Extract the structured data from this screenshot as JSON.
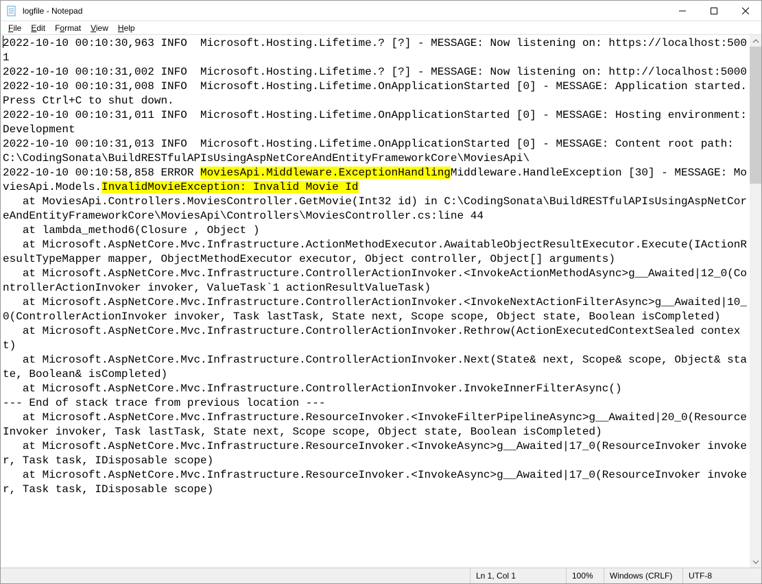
{
  "window": {
    "title": "logfile - Notepad"
  },
  "menu": {
    "file": "File",
    "edit": "Edit",
    "format": "Format",
    "view": "View",
    "help": "Help"
  },
  "log": {
    "pre1": "2022-10-10 00:10:30,963 INFO  Microsoft.Hosting.Lifetime.? [?] - MESSAGE: Now listening on: https://localhost:5001\n2022-10-10 00:10:31,002 INFO  Microsoft.Hosting.Lifetime.? [?] - MESSAGE: Now listening on: http://localhost:5000\n2022-10-10 00:10:31,008 INFO  Microsoft.Hosting.Lifetime.OnApplicationStarted [0] - MESSAGE: Application started. Press Ctrl+C to shut down.\n2022-10-10 00:10:31,011 INFO  Microsoft.Hosting.Lifetime.OnApplicationStarted [0] - MESSAGE: Hosting environment: Development\n2022-10-10 00:10:31,013 INFO  Microsoft.Hosting.Lifetime.OnApplicationStarted [0] - MESSAGE: Content root path: C:\\CodingSonata\\BuildRESTfulAPIsUsingAspNetCoreAndEntityFrameworkCore\\MoviesApi\\\n2022-10-10 00:10:58,858 ERROR ",
    "hl1": "MoviesApi.Middleware.ExceptionHandling",
    "mid1": "Middleware.HandleException [30] - MESSAGE: MoviesApi.Models.",
    "hl2": "InvalidMovieException: Invalid Movie Id",
    "post1": "\n   at MoviesApi.Controllers.MoviesController.GetMovie(Int32 id) in C:\\CodingSonata\\BuildRESTfulAPIsUsingAspNetCoreAndEntityFrameworkCore\\MoviesApi\\Controllers\\MoviesController.cs:line 44\n   at lambda_method6(Closure , Object )\n   at Microsoft.AspNetCore.Mvc.Infrastructure.ActionMethodExecutor.AwaitableObjectResultExecutor.Execute(IActionResultTypeMapper mapper, ObjectMethodExecutor executor, Object controller, Object[] arguments)\n   at Microsoft.AspNetCore.Mvc.Infrastructure.ControllerActionInvoker.<InvokeActionMethodAsync>g__Awaited|12_0(ControllerActionInvoker invoker, ValueTask`1 actionResultValueTask)\n   at Microsoft.AspNetCore.Mvc.Infrastructure.ControllerActionInvoker.<InvokeNextActionFilterAsync>g__Awaited|10_0(ControllerActionInvoker invoker, Task lastTask, State next, Scope scope, Object state, Boolean isCompleted)\n   at Microsoft.AspNetCore.Mvc.Infrastructure.ControllerActionInvoker.Rethrow(ActionExecutedContextSealed context)\n   at Microsoft.AspNetCore.Mvc.Infrastructure.ControllerActionInvoker.Next(State& next, Scope& scope, Object& state, Boolean& isCompleted)\n   at Microsoft.AspNetCore.Mvc.Infrastructure.ControllerActionInvoker.InvokeInnerFilterAsync()\n--- End of stack trace from previous location ---\n   at Microsoft.AspNetCore.Mvc.Infrastructure.ResourceInvoker.<InvokeFilterPipelineAsync>g__Awaited|20_0(ResourceInvoker invoker, Task lastTask, State next, Scope scope, Object state, Boolean isCompleted)\n   at Microsoft.AspNetCore.Mvc.Infrastructure.ResourceInvoker.<InvokeAsync>g__Awaited|17_0(ResourceInvoker invoker, Task task, IDisposable scope)\n   at Microsoft.AspNetCore.Mvc.Infrastructure.ResourceInvoker.<InvokeAsync>g__Awaited|17_0(ResourceInvoker invoker, Task task, IDisposable scope)\n"
  },
  "status": {
    "position": "Ln 1, Col 1",
    "zoom": "100%",
    "eol": "Windows (CRLF)",
    "encoding": "UTF-8"
  }
}
